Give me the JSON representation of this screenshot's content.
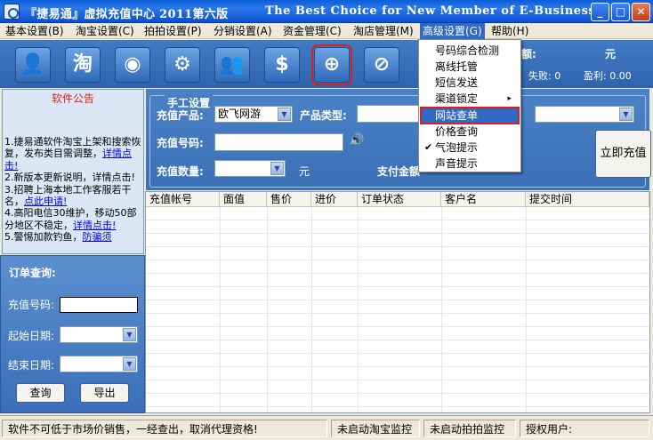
{
  "window": {
    "title": "『捷易通』虚拟充值中心   2011第六版",
    "slogan": "The Best Choice for New Member of E-Business",
    "controls": {
      "minimize": "_",
      "maximize": "□",
      "close": "✕"
    }
  },
  "menu": {
    "items": [
      {
        "label": "基本设置(B)"
      },
      {
        "label": "淘宝设置(C)"
      },
      {
        "label": "拍拍设置(P)"
      },
      {
        "label": "分销设置(A)"
      },
      {
        "label": "资金管理(C)"
      },
      {
        "label": "淘店管理(M)"
      },
      {
        "label": "高级设置(G)"
      },
      {
        "label": "帮助(H)"
      }
    ],
    "dropdown": {
      "items": [
        {
          "label": "号码综合检测"
        },
        {
          "label": "离线托管"
        },
        {
          "label": "短信发送"
        },
        {
          "label": "渠道锁定",
          "submenu": "▸"
        },
        {
          "label": "网站查单"
        },
        {
          "label": "价格查询"
        },
        {
          "label": "气泡提示",
          "check": "✔"
        },
        {
          "label": "声音提示"
        }
      ]
    }
  },
  "toolbar": {
    "icons": [
      {
        "name": "user-icon",
        "glyph": "👤"
      },
      {
        "name": "taobao-icon",
        "glyph": "淘"
      },
      {
        "name": "qq-icon",
        "glyph": "◉"
      },
      {
        "name": "settings-icon",
        "glyph": "⚙"
      },
      {
        "name": "users-icon",
        "glyph": "👥"
      },
      {
        "name": "dollar-icon",
        "glyph": "$"
      },
      {
        "name": "zoom-icon",
        "glyph": "⊕"
      },
      {
        "name": "stop-icon",
        "glyph": "⊘"
      }
    ],
    "stats": {
      "partial_suffix": "额:",
      "currency": "元",
      "fail_label": "失败: 0",
      "profit_label": "盈利: 0.00"
    }
  },
  "notice": {
    "title": "软件公告",
    "items": [
      {
        "text": "1.捷易通软件淘宝上架和搜索恢复，发布类目需调整，",
        "link": "详情点击!"
      },
      {
        "text": "2.新版本更新说明，详情点击!",
        "link": ""
      },
      {
        "text": "3.招聘上海本地工作客服若干名，",
        "link": "点此申请!"
      },
      {
        "text": "4.高阳电信30维护，移动50部分地区不稳定，",
        "link": "详情点击!"
      },
      {
        "text": "5.警惕加款钓鱼，",
        "link": "防骗须"
      }
    ]
  },
  "query": {
    "title": "订单查询:",
    "phone_label": "充值号码:",
    "start_label": "起始日期:",
    "end_label": "结束日期:",
    "search_btn": "查询",
    "export_btn": "导出"
  },
  "manual": {
    "title": "手工设置",
    "product_label": "充值产品:",
    "product_value": "欧飞网游",
    "type_label": "产品类型:",
    "phone_label": "充值号码:",
    "qty_label": "充值数量:",
    "qty_unit": "元",
    "pay_label": "支付金额",
    "submit_btn": "立即充值"
  },
  "table": {
    "columns": [
      "充值帐号",
      "面值",
      "售价",
      "进价",
      "订单状态",
      "客户名",
      "提交时间"
    ]
  },
  "status": {
    "warning": "软件不可低于市场价销售，一经查出，取消代理资格!",
    "taobao_monitor": "未启动淘宝监控",
    "paipai_monitor": "未启动拍拍监控",
    "license": "授权用户:"
  }
}
